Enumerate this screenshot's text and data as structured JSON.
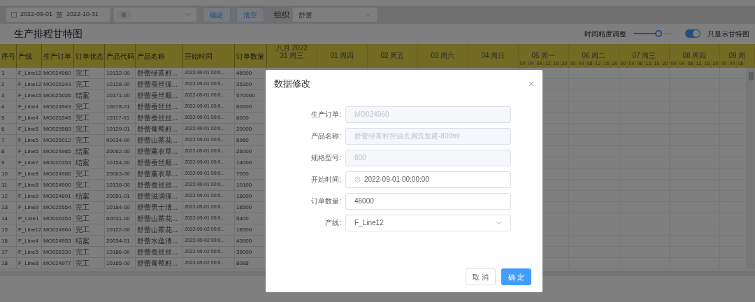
{
  "toolbar": {
    "date_range": {
      "start": "2022-09-01",
      "separator": "至",
      "end": "2022-10-31"
    },
    "filter_select": {
      "has_tag": true
    },
    "buttons": [
      {
        "label": "确定"
      },
      {
        "label": "清空"
      }
    ],
    "org": {
      "label": "组织",
      "value": "舒蕾"
    }
  },
  "title": "生产排程甘特图",
  "precision": {
    "label": "时间精度调整",
    "level": 0.65
  },
  "gantt_only": {
    "label": "只显示甘特图",
    "on": true
  },
  "table": {
    "columns": [
      "序号",
      "产线",
      "生产订单",
      "订单状态",
      "产品代码",
      "产品名称",
      "开始时间",
      "订单数量"
    ],
    "rows": [
      [
        "1",
        "F_Line12",
        "MO024960",
        "完工",
        "10132-00",
        "舒蕾绿茶籽...",
        "2022-09-01 00:0...",
        "46000"
      ],
      [
        "2",
        "F_Line12",
        "MO026343",
        "完工",
        "10128-00",
        "舒蕾蚕丝保...",
        "2022-09-01 00:0...",
        "25300"
      ],
      [
        "3",
        "F_Line15",
        "MO025026",
        "结案",
        "10171-00",
        "舒蕾蚕丝顺...",
        "2022-09-01 00:0...",
        "570000"
      ],
      [
        "4",
        "F_Line4",
        "MO024949",
        "完工",
        "10078-01",
        "舒蕾蚕丝丝...",
        "2022-09-01 00:0...",
        "60000"
      ],
      [
        "5",
        "F_Line4",
        "MO026345",
        "完工",
        "10117-01",
        "舒蕾蚕丝丝...",
        "2022-09-01 00:0...",
        "6000"
      ],
      [
        "6",
        "F_Line5",
        "MO025583",
        "完工",
        "10129-01",
        "舒蕾葡萄籽...",
        "2022-09-01 00:0...",
        "20000"
      ],
      [
        "7",
        "F_Line5",
        "MO025012",
        "完工",
        "90034-00",
        "舒蕾山茶花...",
        "2022-09-01 00:0...",
        "6960"
      ],
      [
        "8",
        "F_Line5",
        "MO024985",
        "结案",
        "20062-00",
        "舒蕾薰衣草...",
        "2022-09-01 00:0...",
        "26000"
      ],
      [
        "9",
        "F_Line7",
        "MO026353",
        "结案",
        "10154-00",
        "舒蕾蚕丝顺...",
        "2022-09-01 00:0...",
        "14000"
      ],
      [
        "10",
        "F_Line8",
        "MO024986",
        "完工",
        "20063-00",
        "舒蕾薰衣草...",
        "2022-09-01 00:0...",
        "7000"
      ],
      [
        "11",
        "F_Line8",
        "MO024900",
        "完工",
        "10138-00",
        "舒蕾蚕丝丝...",
        "2022-09-01 00:0...",
        "10100"
      ],
      [
        "12",
        "F_Line9",
        "MO024891",
        "结案",
        "20051-01",
        "舒蕾滋润保...",
        "2022-09-01 00:0...",
        "18000"
      ],
      [
        "13",
        "F_Line9",
        "MO025554",
        "完工",
        "10184-00",
        "舒蕾男士清...",
        "2022-09-01 00:0...",
        "18500"
      ],
      [
        "14",
        "P_Line1",
        "MO026354",
        "完工",
        "60031-00",
        "舒蕾山茶花...",
        "2022-09-01 00:0...",
        "5400"
      ],
      [
        "15",
        "F_Line12",
        "MO024964",
        "完工",
        "10122-00",
        "舒蕾山茶花...",
        "2022-09-02 00:0...",
        "18500"
      ],
      [
        "16",
        "F_Line4",
        "MO024953",
        "结案",
        "20034-01",
        "舒蕾水蕴清...",
        "2022-09-02 00:0...",
        "43500"
      ],
      [
        "17",
        "F_Line5",
        "MO026330",
        "完工",
        "10186-00",
        "舒蕾蚕丝丝...",
        "2022-09-02 00:0...",
        "35000"
      ],
      [
        "18",
        "F_Line8",
        "MO024977",
        "完工",
        "10165-00",
        "舒蕾葡萄籽...",
        "2022-09-02 00:0...",
        "8088"
      ]
    ]
  },
  "gantt": {
    "month": "八月 2022",
    "days": [
      {
        "label": "31 周三"
      },
      {
        "label": "01 周四"
      },
      {
        "label": "02 周五"
      },
      {
        "label": "03 周六"
      },
      {
        "label": "04 周日"
      },
      {
        "label": "05 周一",
        "hours": [
          "00",
          "04",
          "08",
          "12",
          "16",
          "20"
        ]
      },
      {
        "label": "06 周二",
        "hours": [
          "00",
          "04",
          "08",
          "12",
          "16",
          "20"
        ]
      },
      {
        "label": "07 周三",
        "hours": [
          "00",
          "04",
          "08",
          "12",
          "16",
          "20"
        ]
      },
      {
        "label": "08 周四",
        "hours": [
          "00",
          "04",
          "08",
          "12",
          "16",
          "20"
        ]
      },
      {
        "label": "09 周",
        "hours": [
          "00",
          "04",
          "08"
        ]
      }
    ]
  },
  "dialog": {
    "title": "数据修改",
    "fields": [
      {
        "label": "生产订单:",
        "value": "MO024960",
        "kind": "text",
        "disabled": true
      },
      {
        "label": "产品名称:",
        "value": "舒蕾绿茶籽控油去屑洗发露-800ml",
        "kind": "text",
        "disabled": true
      },
      {
        "label": "规格型号:",
        "value": "800",
        "kind": "text",
        "disabled": true
      },
      {
        "label": "开始时间:",
        "value": "2022-09-01 00:00:00",
        "kind": "datetime",
        "disabled": false
      },
      {
        "label": "订单数量:",
        "value": "46000",
        "kind": "text",
        "disabled": false
      },
      {
        "label": "产线:",
        "value": "F_Line12",
        "kind": "select",
        "disabled": false
      }
    ],
    "buttons": [
      {
        "label": "取 消",
        "kind": "default"
      },
      {
        "label": "确 定",
        "kind": "primary"
      }
    ]
  }
}
